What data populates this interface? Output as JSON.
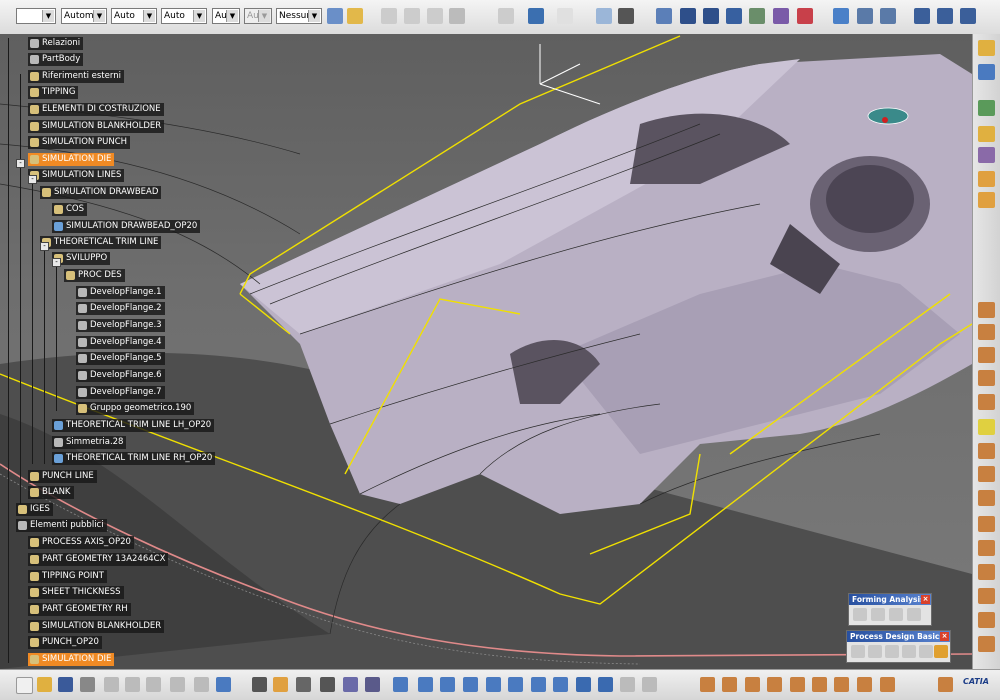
{
  "toolbar": {
    "selects": [
      {
        "value": "",
        "name": "line-color-select"
      },
      {
        "value": "Automa",
        "name": "color-select"
      },
      {
        "value": "Auto",
        "name": "line-type-select"
      },
      {
        "value": "Auto",
        "name": "line-weight-select"
      },
      {
        "value": "Aut",
        "name": "point-type-select"
      },
      {
        "value": "Aut",
        "name": "layer-type-select"
      },
      {
        "value": "Nessuno",
        "name": "layer-select"
      }
    ]
  },
  "tree": {
    "nodes": [
      {
        "label": "Relazioni",
        "hl": false
      },
      {
        "label": "PartBody",
        "hl": false
      },
      {
        "label": "Riferimenti esterni",
        "hl": false
      },
      {
        "label": "TIPPING",
        "hl": false
      },
      {
        "label": "ELEMENTI DI COSTRUZIONE",
        "hl": false
      },
      {
        "label": "SIMULATION BLANKHOLDER",
        "hl": false
      },
      {
        "label": "SIMULATION PUNCH",
        "hl": false
      },
      {
        "label": "SIMULATION DIE",
        "hl": true
      },
      {
        "label": "SIMULATION LINES",
        "hl": false
      },
      {
        "label": "SIMULATION DRAWBEAD",
        "hl": false
      },
      {
        "label": "COS",
        "hl": false
      },
      {
        "label": "SIMULATION DRAWBEAD_OP20",
        "hl": false
      },
      {
        "label": "THEORETICAL TRIM LINE",
        "hl": false
      },
      {
        "label": "SVILUPPO",
        "hl": false
      },
      {
        "label": "PROC DES",
        "hl": false
      },
      {
        "label": "DevelopFlange.1",
        "hl": false
      },
      {
        "label": "DevelopFlange.2",
        "hl": false
      },
      {
        "label": "DevelopFlange.3",
        "hl": false
      },
      {
        "label": "DevelopFlange.4",
        "hl": false
      },
      {
        "label": "DevelopFlange.5",
        "hl": false
      },
      {
        "label": "DevelopFlange.6",
        "hl": false
      },
      {
        "label": "DevelopFlange.7",
        "hl": false
      },
      {
        "label": "Gruppo geometrico.190",
        "hl": false
      },
      {
        "label": "THEORETICAL TRIM LINE LH_OP20",
        "hl": false
      },
      {
        "label": "Simmetria.28",
        "hl": false
      },
      {
        "label": "THEORETICAL TRIM LINE RH_OP20",
        "hl": false
      },
      {
        "label": "PUNCH LINE",
        "hl": false
      },
      {
        "label": "BLANK",
        "hl": false
      },
      {
        "label": "IGES",
        "hl": false
      },
      {
        "label": "Elementi pubblici",
        "hl": false
      },
      {
        "label": "PROCESS AXIS_OP20",
        "hl": false
      },
      {
        "label": "PART GEOMETRY 13A2464CX",
        "hl": false
      },
      {
        "label": "TIPPING POINT",
        "hl": false
      },
      {
        "label": "SHEET THICKNESS",
        "hl": false
      },
      {
        "label": "PART GEOMETRY RH",
        "hl": false
      },
      {
        "label": "SIMULATION BLANKHOLDER",
        "hl": false
      },
      {
        "label": "PUNCH_OP20",
        "hl": false
      },
      {
        "label": "SIMULATION DIE",
        "hl": true
      }
    ]
  },
  "palettes": {
    "forming_analysis": {
      "title": "Forming Analysis"
    },
    "process_design_basics": {
      "title": "Process Design Basics"
    }
  },
  "logo": {
    "text": "CATIA"
  },
  "colors": {
    "highlight": "#f08a24",
    "trim_line": "#f0e000",
    "blank_edge": "#e08080",
    "surface": "#b9b0c4"
  }
}
